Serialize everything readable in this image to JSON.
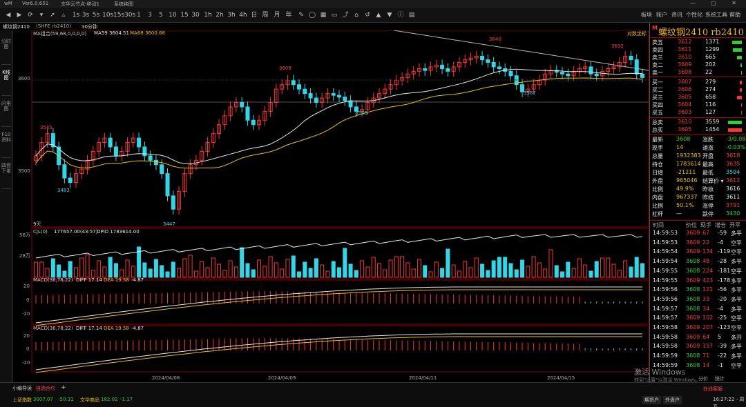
{
  "titlebar": {
    "app": "wM",
    "version": "Ver6.0.651",
    "items": [
      "文华云节点-移动1",
      "系统纯图"
    ]
  },
  "toolbar": {
    "periods": [
      "1",
      "3",
      "5",
      "10",
      "15",
      "30",
      "1h",
      "2h",
      "3h",
      "4h",
      "日",
      "周",
      "月",
      "年"
    ],
    "icons_left": [
      "back-icon",
      "forward-icon",
      "refresh-icon",
      "dropdown-icon",
      "arrow-icon",
      "triangle-icon"
    ],
    "tool_icons": [
      "edit-icon",
      "circle-icon",
      "grid-icon",
      "window-icon",
      "share-icon",
      "home-icon",
      "undo-icon",
      "up-icon",
      "down-icon",
      "info-icon",
      "note-icon"
    ],
    "right": [
      "板块",
      "账户",
      "资讯",
      "个性化",
      "系统工具",
      "帮助"
    ],
    "left_labels": [
      "1s",
      "3s",
      "5s",
      "10s",
      "15s",
      "30s"
    ]
  },
  "subbar": {
    "symbol": "螺纹钢2410",
    "contract": "(SHFE rb2410)",
    "period": "30分钟"
  },
  "sidetabs": [
    "分时图",
    "K线图",
    "闪电图",
    "F10资料",
    "四宫下单"
  ],
  "chart": {
    "ma_label": "MA组合(59,68,0,0,0,0)",
    "ma59": "MA59 3604.51",
    "ma68": "MA68 3600.68",
    "log_label": "对数坐标",
    "y_price": [
      "3600",
      "3500"
    ],
    "annotations": [
      "3545",
      "3483",
      "3447",
      "3608",
      "3566",
      "3640",
      "3587",
      "3632"
    ],
    "nine_label": "9天",
    "vol_label": "CJL(0)",
    "vol_value": "177657.00(43:57)",
    "opid": "OPID 1783614.00",
    "vol_y": [
      "56万",
      "28万"
    ],
    "macd_label": "MACD(36,78,22)",
    "diff": "DIFF 17.14",
    "dea": "DEA 19.58",
    "macd_val": "-4.87",
    "macd_y": [
      "20",
      "0",
      "-20"
    ],
    "dates": [
      "2024/04/08",
      "2024/04/09",
      "2024/04/11",
      "2024/04/15"
    ],
    "chart_data": {
      "type": "candlestick",
      "y_range": [
        3440,
        3650
      ]
    }
  },
  "quote": {
    "title": "螺纹钢2410  rb2410",
    "m": "M",
    "asks": [
      {
        "label": "卖五",
        "price": "3612",
        "vol": "1371"
      },
      {
        "label": "卖四",
        "price": "3611",
        "vol": "1299"
      },
      {
        "label": "卖三",
        "price": "3610",
        "vol": "665"
      },
      {
        "label": "卖二",
        "price": "3609",
        "vol": "202"
      },
      {
        "label": "卖一",
        "price": "3608",
        "vol": "22"
      }
    ],
    "bids": [
      {
        "label": "买一",
        "price": "3607",
        "vol": "279"
      },
      {
        "label": "买二",
        "price": "3606",
        "vol": "274"
      },
      {
        "label": "买三",
        "price": "3605",
        "vol": "658"
      },
      {
        "label": "买四",
        "price": "3604",
        "vol": "116"
      },
      {
        "label": "买五",
        "price": "3603",
        "vol": "127"
      }
    ],
    "totals": [
      {
        "label": "总卖",
        "price": "3610",
        "vol": "3559"
      },
      {
        "label": "总买",
        "price": "3605",
        "vol": "1454"
      }
    ],
    "stats": [
      {
        "l1": "最新",
        "v1": "3608",
        "l2": "涨跌",
        "v2": "-3/0.08%"
      },
      {
        "l1": "现手",
        "v1": "14",
        "l2": "速涨",
        "v2": "-0.03%"
      },
      {
        "l1": "总量",
        "v1": "1932383",
        "l2": "开盘",
        "v2": "3618"
      },
      {
        "l1": "持仓",
        "v1": "1783614",
        "l2": "最高",
        "v2": "3635"
      },
      {
        "l1": "日增",
        "v1": "-21211",
        "l2": "最低",
        "v2": "3594"
      },
      {
        "l1": "外盘",
        "v1": "965046",
        "l2": "结算价 ▾",
        "v2": "3612"
      },
      {
        "l1": "比例",
        "v1": "49.9%",
        "l2": "昨收",
        "v2": "3616"
      },
      {
        "l1": "内盘",
        "v1": "967337",
        "l2": "昨结",
        "v2": "3611"
      },
      {
        "l1": "比例",
        "v1": "50.1%",
        "l2": "涨停",
        "v2": "3791"
      },
      {
        "l1": "杠杆",
        "v1": "—",
        "l2": "跌停",
        "v2": "3430"
      }
    ],
    "tick_header": [
      "时间",
      "价位",
      "现手",
      "增仓",
      "开平"
    ],
    "ticks": [
      [
        "14:59:53",
        "3609",
        "67",
        "-59",
        "多平"
      ],
      [
        "14:59:53",
        "3609",
        "22",
        "-4",
        "空平"
      ],
      [
        "14:59:54",
        "3609",
        "134",
        "-119",
        "空平"
      ],
      [
        "14:59:54",
        "3608",
        "48",
        "-28",
        "多平"
      ],
      [
        "14:59:55",
        "3608",
        "224",
        "-181",
        "空平"
      ],
      [
        "14:59:55",
        "3609",
        "423",
        "-178",
        "多平"
      ],
      [
        "14:59:56",
        "3608",
        "121",
        "-56",
        "多平"
      ],
      [
        "14:59:56",
        "3608",
        "33",
        "-20",
        "多平"
      ],
      [
        "14:59:57",
        "3608",
        "34",
        "-4",
        "多平"
      ],
      [
        "14:59:57",
        "3609",
        "102",
        "-25",
        "空平"
      ],
      [
        "14:59:58",
        "3609",
        "207",
        "-123",
        "空平"
      ],
      [
        "14:59:58",
        "3609",
        "64",
        "5",
        "多开"
      ],
      [
        "14:59:58",
        "3609",
        "157",
        "-39",
        "多平"
      ],
      [
        "14:59:59",
        "3608",
        "71",
        "-22",
        "多平"
      ],
      [
        "14:59:59",
        "3608",
        "14",
        "-1",
        "空平"
      ]
    ],
    "bottom_tabs": [
      "分价",
      "统计"
    ]
  },
  "statusbar": {
    "tab1": "小编导读",
    "tab2": "自选合约",
    "add": "+",
    "idx1_name": "上证指数",
    "idx1_val": "3007.07",
    "idx1_chg": "-50.31",
    "idx2_name": "文华商品",
    "idx2_val": "182.02",
    "idx2_chg": "-1.17",
    "btn1": "期货户",
    "btn2": "外盘户",
    "clock": "16:27:22 - 周五",
    "online": "在线客服",
    "watermark1": "激活 Windows",
    "watermark2": "转到\"设置\"以激活 Windows。"
  }
}
